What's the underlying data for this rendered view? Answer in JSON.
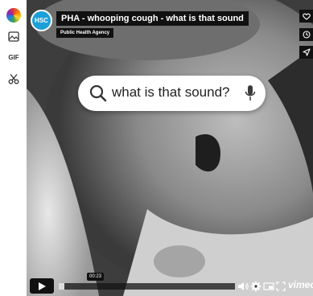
{
  "toolbar": {
    "items": [
      {
        "name": "color-picker"
      },
      {
        "name": "image-icon"
      },
      {
        "label": "GIF"
      },
      {
        "name": "scissors-icon"
      }
    ]
  },
  "video": {
    "logo_text": "HSC",
    "title": "PHA - whooping cough - what is that sound",
    "byline": "Public Health Agency",
    "search_text": "what is that sound?",
    "progress": 0.03,
    "time_tooltip": "00:23",
    "brand": "vimeo"
  },
  "colors": {
    "logo_blue": "#1c9fd8",
    "bar_dark": "#111111",
    "mic_accent": "#3b3b3b"
  }
}
